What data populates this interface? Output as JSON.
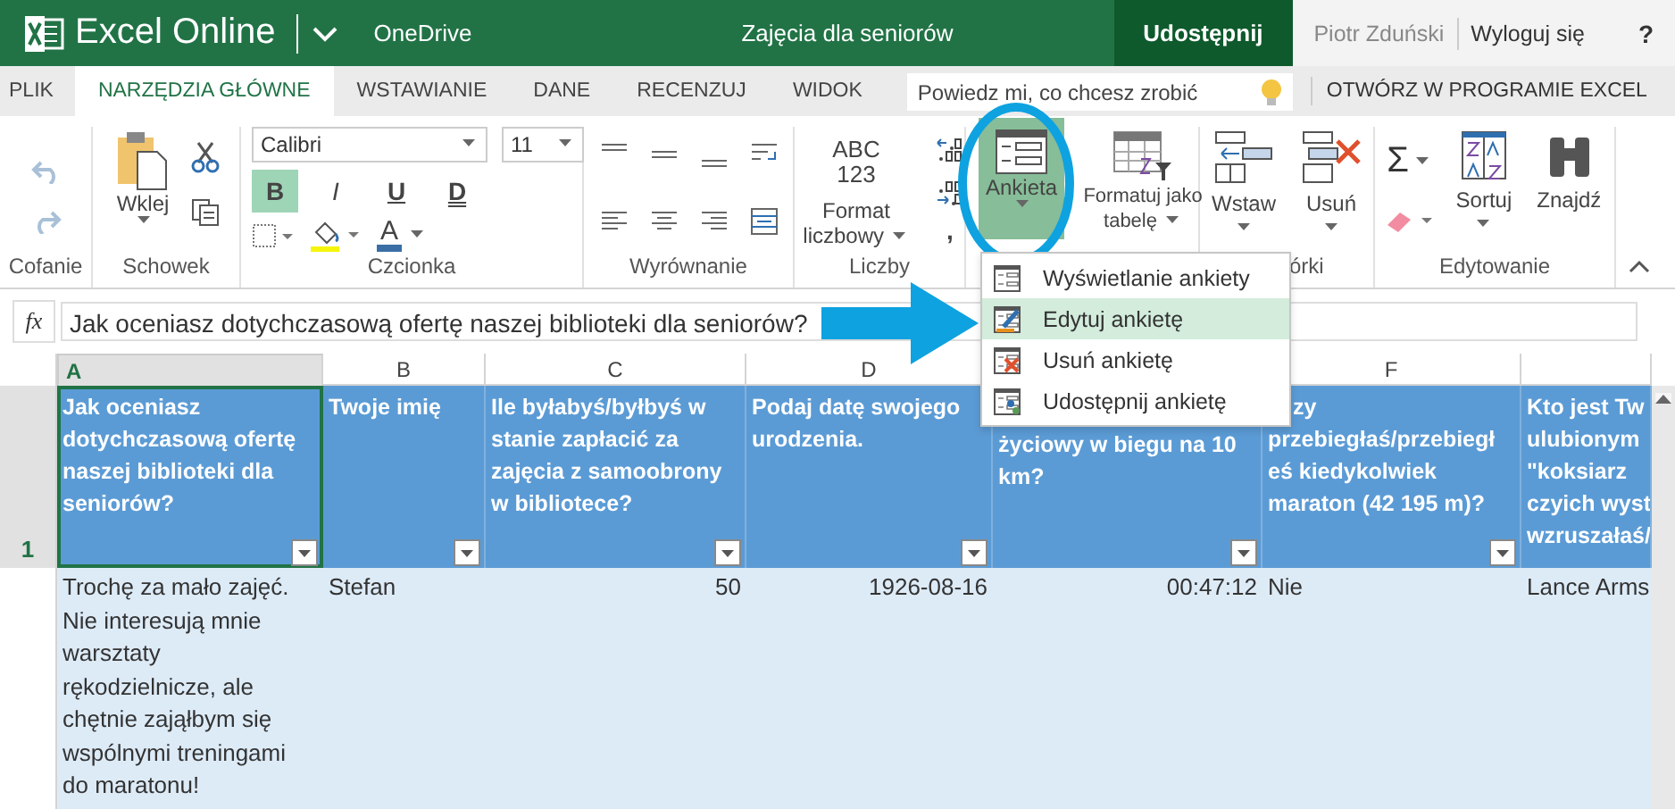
{
  "app": {
    "name": "Excel Online",
    "location": "OneDrive",
    "document_title": "Zajęcia dla seniorów",
    "share_button": "Udostępnij",
    "user": "Piotr Zduński",
    "sign_out": "Wyloguj się",
    "help": "?"
  },
  "tabs": [
    {
      "label": "PLIK",
      "selected": false
    },
    {
      "label": "NARZĘDZIA GŁÓWNE",
      "selected": true
    },
    {
      "label": "WSTAWIANIE",
      "selected": false
    },
    {
      "label": "DANE",
      "selected": false
    },
    {
      "label": "RECENZUJ",
      "selected": false
    },
    {
      "label": "WIDOK",
      "selected": false
    }
  ],
  "tell_me": {
    "placeholder": "Powiedz mi, co chcesz zrobić"
  },
  "open_in_desktop": "OTWÓRZ W PROGRAMIE EXCEL",
  "ribbon": {
    "undo": {
      "label": "Cofanie"
    },
    "clipboard": {
      "label": "Schowek",
      "paste": "Wklej"
    },
    "font": {
      "label": "Czcionka",
      "family": "Calibri",
      "size": "11",
      "color_glyph": "A",
      "styles": [
        {
          "glyph": "B",
          "kind": "bold",
          "selected": true
        },
        {
          "glyph": "I",
          "kind": "italic",
          "selected": false
        },
        {
          "glyph": "U",
          "kind": "underline",
          "selected": false
        },
        {
          "glyph": "D",
          "kind": "double",
          "selected": false
        }
      ]
    },
    "alignment": {
      "label": "Wyrównanie"
    },
    "number": {
      "label": "Liczby",
      "format_glyph": [
        "ABC",
        "123"
      ],
      "format_button": "Format liczbowy",
      "comma": ","
    },
    "survey": {
      "label": "Ankieta",
      "open": true,
      "format_as_table": "Formatuj jako tabelę"
    },
    "cells": {
      "label": "órki",
      "insert": "Wstaw",
      "delete": "Usuń"
    },
    "editing": {
      "label": "Edytowanie",
      "autosum_glyph": "Σ",
      "sort": "Sortuj",
      "find": "Znajdź"
    }
  },
  "formula_bar": {
    "function_label": "fx",
    "value": "Jak oceniasz dotychczasową ofertę naszej biblioteki dla seniorów?"
  },
  "columns": [
    {
      "letter": "A",
      "selected": true
    },
    {
      "letter": "B",
      "selected": false
    },
    {
      "letter": "C",
      "selected": false
    },
    {
      "letter": "D",
      "selected": false
    },
    {
      "letter": "F",
      "selected": false
    },
    {
      "selected": false
    }
  ],
  "header_row": {
    "number": "1",
    "cells": [
      "Jak oceniasz\ndotychczasową ofertę\nnaszej biblioteki dla\nseniorów?",
      "Twoje imię",
      "Ile byłabyś/byłbyś w\nstanie zapłacić za\nzajęcia z samoobrony\nw bibliotece?",
      "Podaj datę swojego\nurodzenia.",
      "życiowy w biegu na 10\nkm?",
      "zy\nprzebiegłaś/przebiegł\neś kiedykolwiek\nmaraton (42 195 m)?",
      "Kto jest Tw\nulubionym\n\"koksiarz\nczyich wyst\nwzruszałaś/"
    ]
  },
  "data_row": {
    "cells": [
      {
        "text": "Trochę za mało zajęć.\nNie interesują mnie\nwarsztaty\nrękodzielnicze, ale\nchętnie zająłbym się\nwspólnymi treningami\ndo maratonu!",
        "kind": "text"
      },
      {
        "text": "Stefan",
        "kind": "text"
      },
      {
        "text": "50",
        "kind": "number"
      },
      {
        "text": "1926-08-16",
        "kind": "number"
      },
      {
        "text": "00:47:12",
        "kind": "number"
      },
      {
        "text": "Nie",
        "kind": "text"
      },
      {
        "text": "Lance Arms",
        "kind": "text"
      }
    ]
  },
  "survey_menu": [
    {
      "label": "Wyświetlanie ankiety",
      "kind": "view",
      "selected": false
    },
    {
      "label": "Edytuj ankietę",
      "kind": "edit",
      "selected": true
    },
    {
      "label": "Usuń ankietę",
      "kind": "delete",
      "selected": false
    },
    {
      "label": "Udostępnij ankietę",
      "kind": "share",
      "selected": false
    }
  ]
}
